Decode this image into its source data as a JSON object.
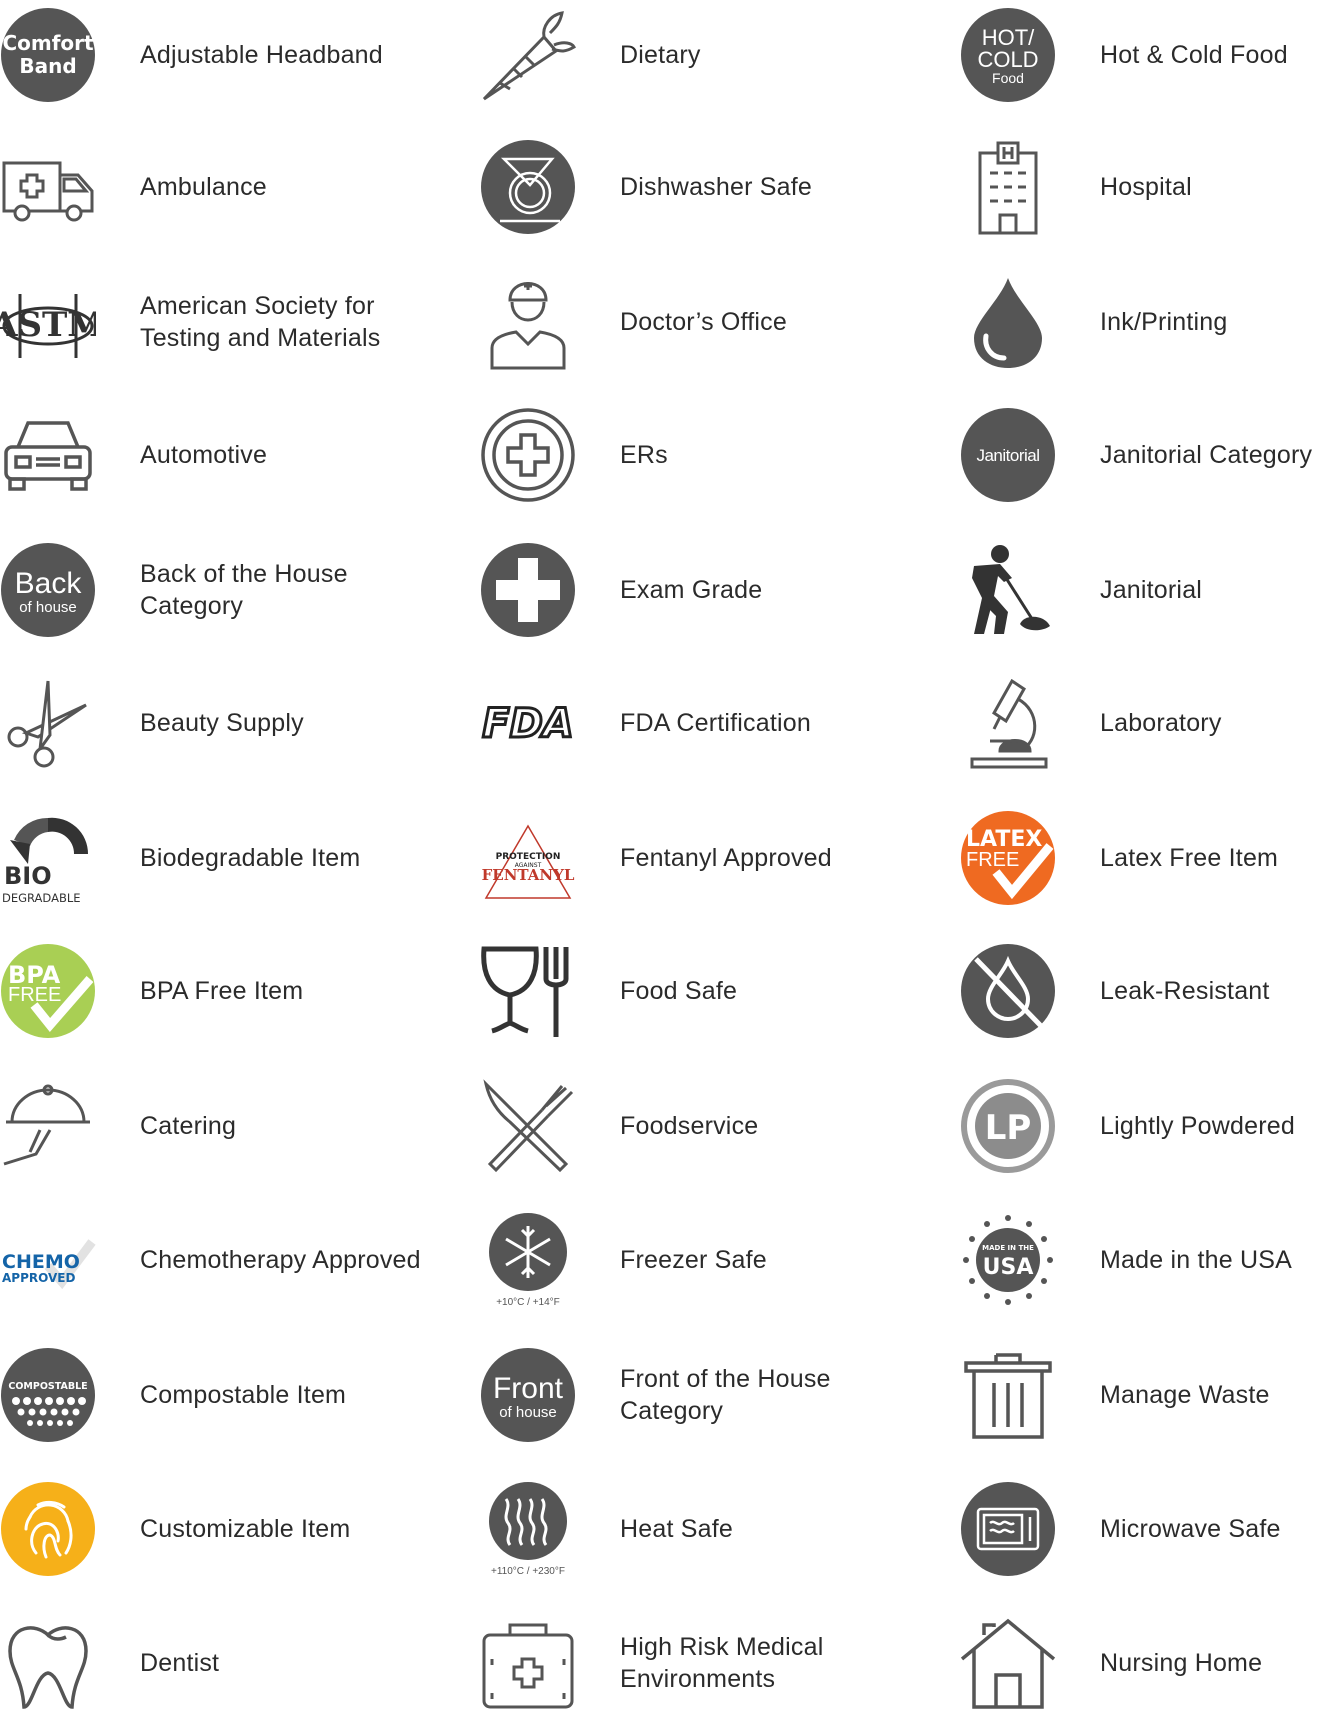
{
  "columns": [
    {
      "items": [
        {
          "label": "Adjustable Headband",
          "icon": "comfort-band-icon",
          "badge": [
            "Comfort",
            "Band"
          ]
        },
        {
          "label": "Ambulance",
          "icon": "ambulance-icon"
        },
        {
          "label": "American Society for Testing and Materials",
          "icon": "astm-icon",
          "badge": [
            "ASTM"
          ]
        },
        {
          "label": "Automotive",
          "icon": "car-icon"
        },
        {
          "label": "Back of the House Category",
          "icon": "back-of-house-icon",
          "badge": [
            "Back",
            "of house"
          ]
        },
        {
          "label": "Beauty Supply",
          "icon": "scissors-icon"
        },
        {
          "label": "Biodegradable Item",
          "icon": "biodegradable-icon",
          "badge": [
            "BIO",
            "DEGRADABLE"
          ]
        },
        {
          "label": "BPA Free Item",
          "icon": "bpa-free-icon",
          "badge": [
            "BPA",
            "FREE"
          ]
        },
        {
          "label": "Catering",
          "icon": "catering-cloche-icon"
        },
        {
          "label": "Chemotherapy Approved",
          "icon": "chemo-approved-icon",
          "badge": [
            "CHEMO",
            "APPROVED"
          ]
        },
        {
          "label": "Compostable Item",
          "icon": "compostable-icon",
          "badge": [
            "COMPOSTABLE"
          ]
        },
        {
          "label": "Customizable Item",
          "icon": "fingerprint-icon"
        },
        {
          "label": "Dentist",
          "icon": "tooth-icon"
        }
      ]
    },
    {
      "items": [
        {
          "label": "Dietary",
          "icon": "carrot-icon"
        },
        {
          "label": "Dishwasher Safe",
          "icon": "dishwasher-icon"
        },
        {
          "label": "Doctor’s Office",
          "icon": "doctor-icon"
        },
        {
          "label": "ERs",
          "icon": "er-cross-icon"
        },
        {
          "label": "Exam Grade",
          "icon": "exam-cross-icon"
        },
        {
          "label": "FDA Certification",
          "icon": "fda-icon",
          "badge": [
            "FDA"
          ]
        },
        {
          "label": "Fentanyl Approved",
          "icon": "fentanyl-icon",
          "badge": [
            "PROTECTION",
            "AGAINST",
            "FENTANYL"
          ]
        },
        {
          "label": "Food Safe",
          "icon": "glass-fork-icon"
        },
        {
          "label": "Foodservice",
          "icon": "knife-fork-icon"
        },
        {
          "label": "Freezer Safe",
          "icon": "snowflake-icon",
          "badge": [
            "+10°C  /  +14°F"
          ]
        },
        {
          "label": "Front of the House Category",
          "icon": "front-of-house-icon",
          "badge": [
            "Front",
            "of house"
          ]
        },
        {
          "label": "Heat Safe",
          "icon": "heat-waves-icon",
          "badge": [
            "+110°C  /  +230°F"
          ]
        },
        {
          "label": "High Risk Medical Environments",
          "icon": "medical-kit-icon"
        }
      ]
    },
    {
      "items": [
        {
          "label": "Hot & Cold Food",
          "icon": "hot-cold-icon",
          "badge": [
            "HOT/",
            "COLD",
            "Food"
          ]
        },
        {
          "label": "Hospital",
          "icon": "hospital-building-icon"
        },
        {
          "label": "Ink/Printing",
          "icon": "ink-drop-icon"
        },
        {
          "label": "Janitorial Category",
          "icon": "janitorial-category-icon",
          "badge": [
            "Janitorial"
          ]
        },
        {
          "label": "Janitorial",
          "icon": "mopping-person-icon"
        },
        {
          "label": "Laboratory",
          "icon": "microscope-icon"
        },
        {
          "label": "Latex Free Item",
          "icon": "latex-free-icon",
          "badge": [
            "LATEX",
            "FREE"
          ]
        },
        {
          "label": "Leak-Resistant",
          "icon": "leak-resistant-icon"
        },
        {
          "label": "Lightly Powdered",
          "icon": "lightly-powdered-icon",
          "badge": [
            "LP"
          ]
        },
        {
          "label": "Made in the USA",
          "icon": "made-in-usa-icon",
          "badge": [
            "MADE IN THE",
            "USA"
          ]
        },
        {
          "label": "Manage Waste",
          "icon": "trash-can-icon"
        },
        {
          "label": "Microwave Safe",
          "icon": "microwave-icon"
        },
        {
          "label": "Nursing Home",
          "icon": "house-icon"
        }
      ]
    }
  ],
  "colors": {
    "icon_gray": "#555555",
    "text": "#2b2b2b",
    "bpa_green": "#a9cf54",
    "latex_orange": "#ef6a21",
    "fingerprint_yellow": "#f6b019",
    "chemo_blue": "#1464a8",
    "fentanyl_red": "#c0392b"
  }
}
